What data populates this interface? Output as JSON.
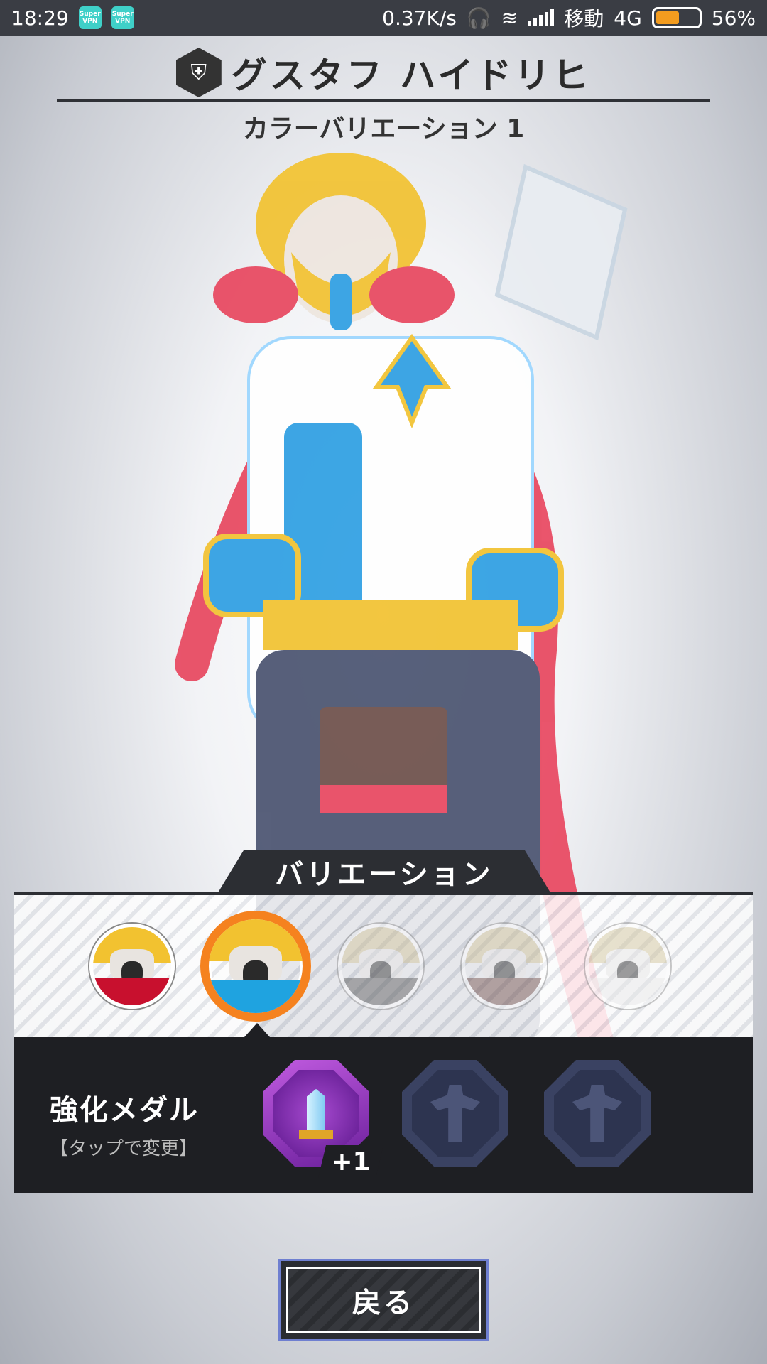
{
  "status_bar": {
    "time": "18:29",
    "vpn_icons": [
      "Super VPN",
      "Super VPN"
    ],
    "network_speed": "0.37K/s",
    "carrier": "移動",
    "network_type": "4G",
    "battery_percent": "56%",
    "battery_level": 0.56
  },
  "header": {
    "character_name": "グスタフ ハイドリヒ",
    "variation_caption": "カラーバリエーション 1"
  },
  "variation": {
    "tab_label": "バリエーション",
    "selected_index": 1,
    "avatars": [
      {
        "name": "variation-0",
        "state": "available",
        "coat_color": "#c8102e"
      },
      {
        "name": "variation-1",
        "state": "selected",
        "coat_color": "#1fa3e0"
      },
      {
        "name": "variation-2",
        "state": "locked",
        "coat_color": "#555555"
      },
      {
        "name": "variation-3",
        "state": "locked",
        "coat_color": "#b33a2a"
      },
      {
        "name": "variation-4",
        "state": "locked",
        "coat_color": "#e8e8e8"
      }
    ]
  },
  "medals": {
    "title": "強化メダル",
    "subtitle": "【タップで変更】",
    "active_bonus": "+1",
    "slots": [
      "sword-medal",
      "empty-medal",
      "empty-medal"
    ]
  },
  "back_button": {
    "label": "戻る"
  },
  "colors": {
    "accent_orange": "#f5821f",
    "panel_dark": "#1e1f23",
    "medal_purple": "#8a2fc0"
  }
}
